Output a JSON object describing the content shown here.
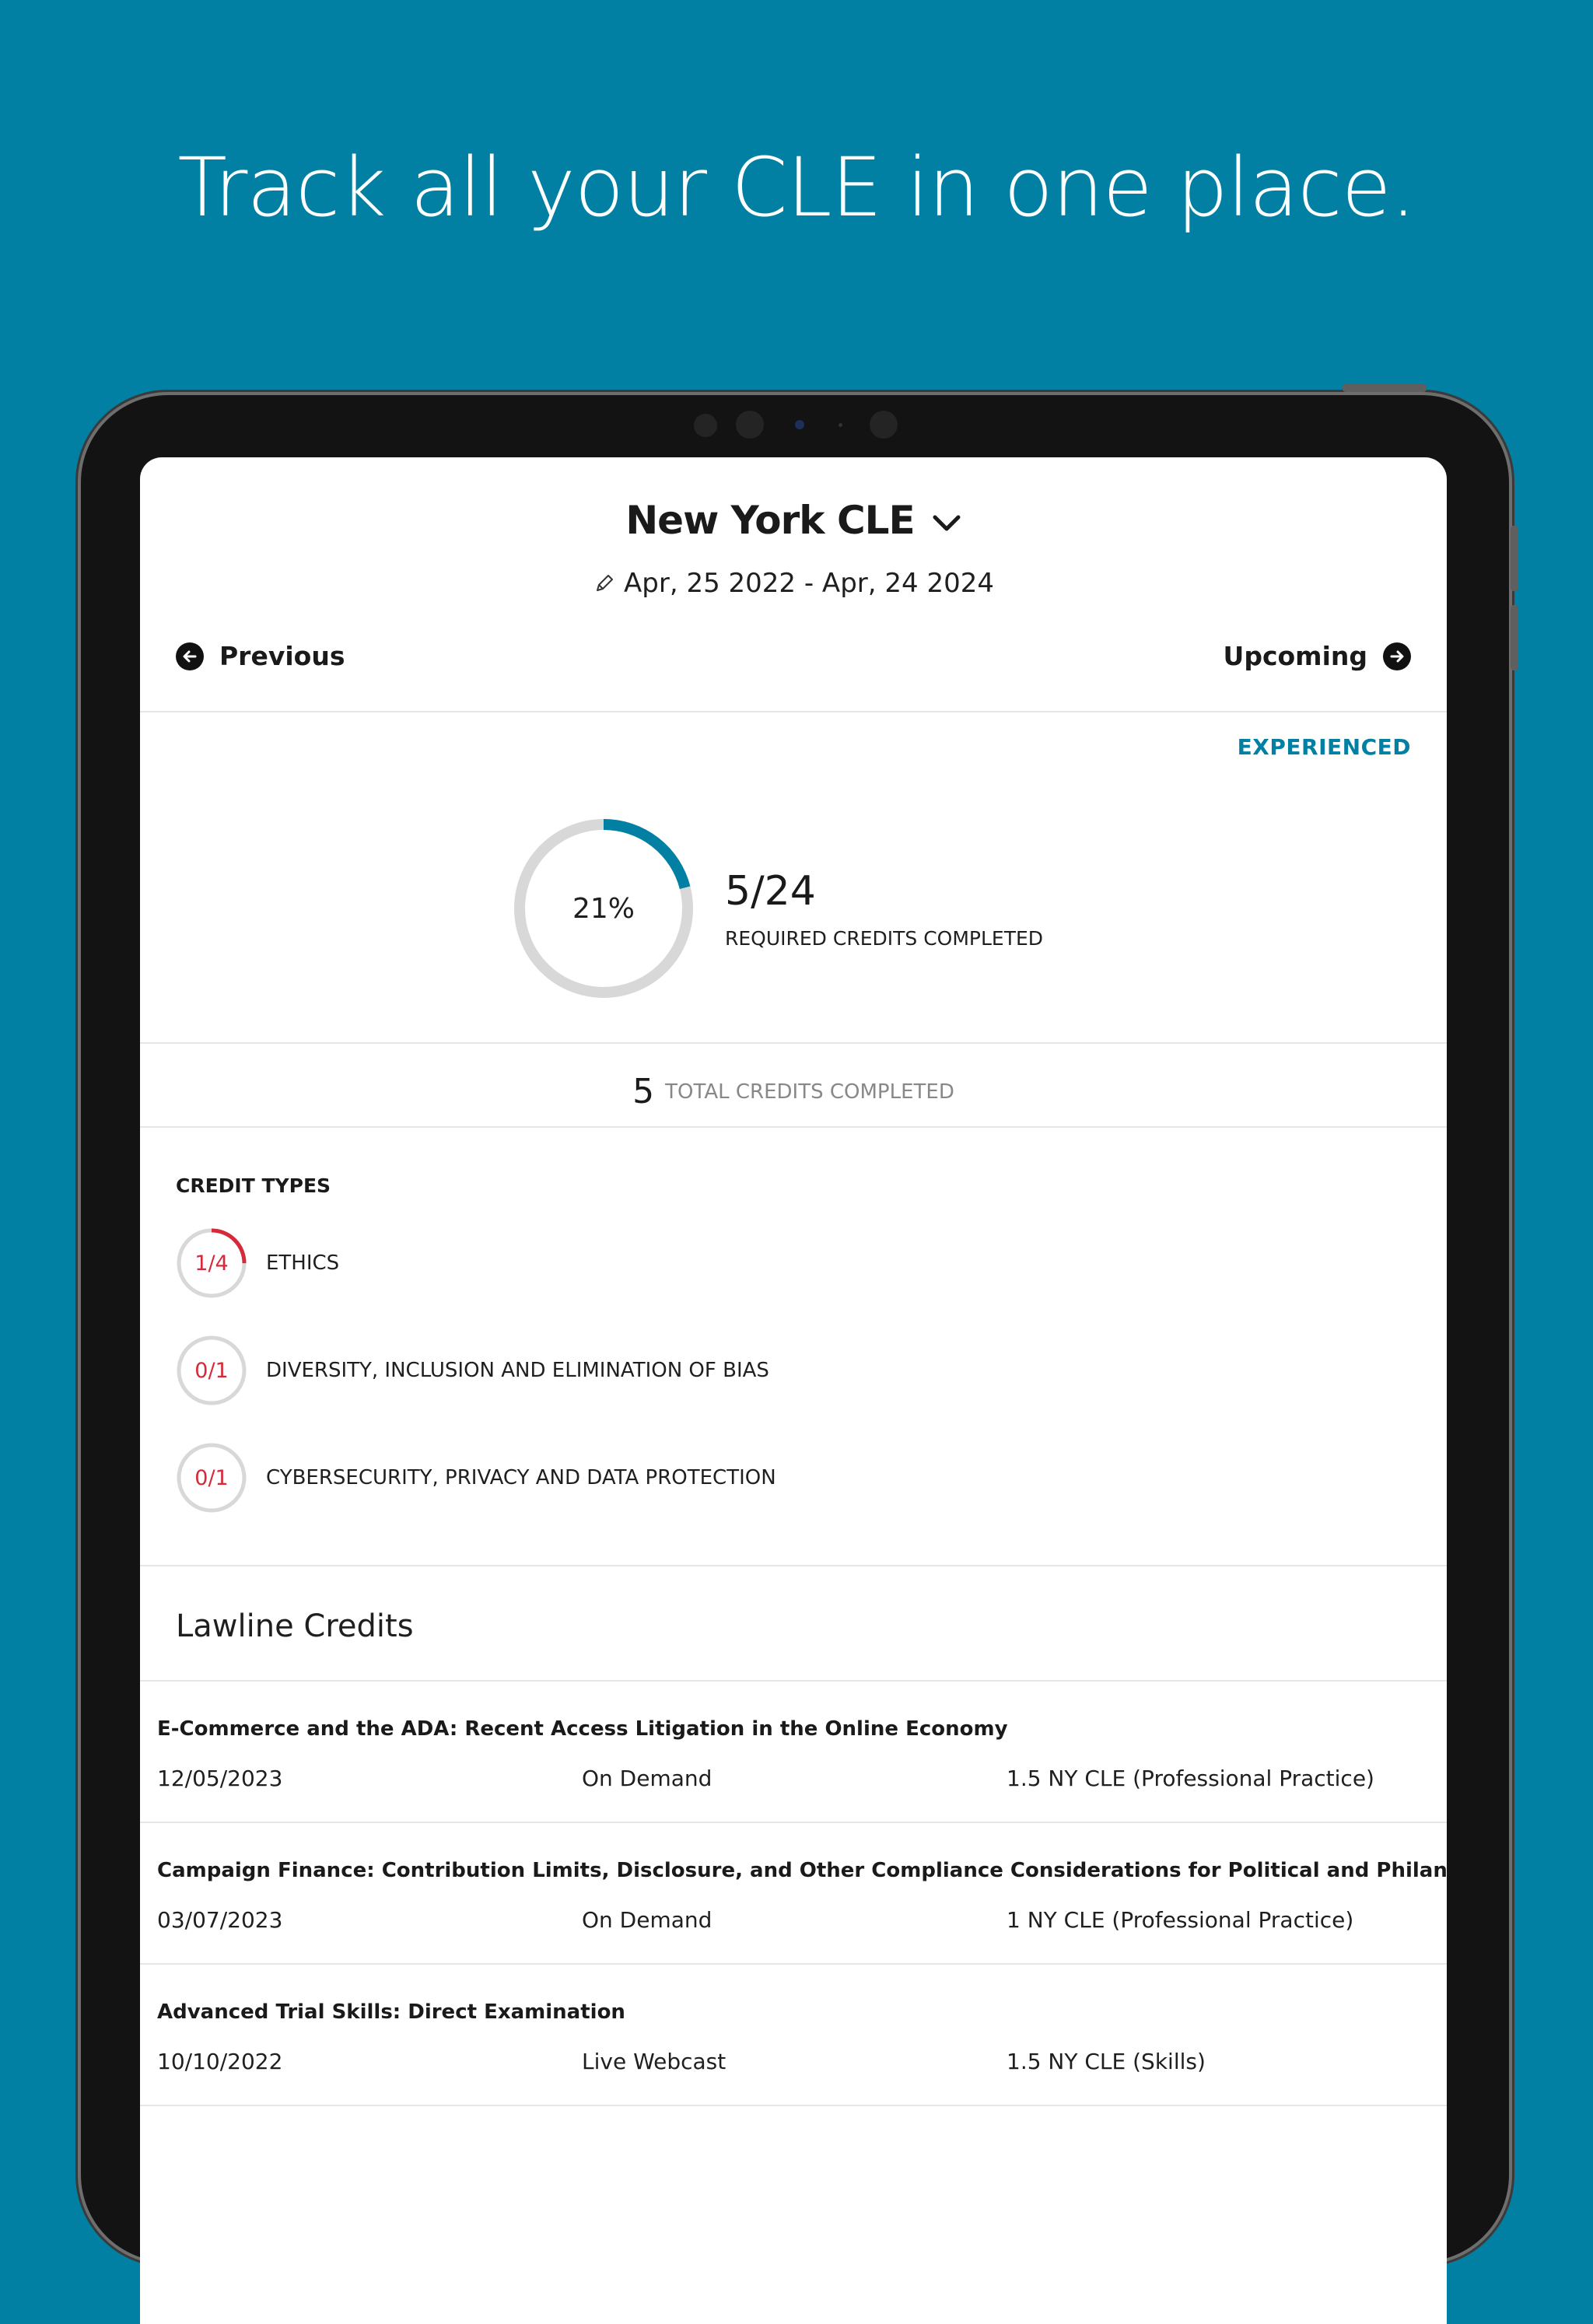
{
  "headline": "Track all your CLE in one place.",
  "header": {
    "title": "New York CLE",
    "date_range": "Apr, 25 2022 - Apr, 24 2024",
    "previous_label": "Previous",
    "upcoming_label": "Upcoming"
  },
  "status_badge": "EXPERIENCED",
  "progress": {
    "percent_label": "21%",
    "fraction": 0.21,
    "required_count": "5/24",
    "required_label": "REQUIRED CREDITS COMPLETED"
  },
  "total": {
    "count": "5",
    "label": "TOTAL CREDITS COMPLETED"
  },
  "credit_types": {
    "title": "CREDIT TYPES",
    "items": [
      {
        "fraction_label": "1/4",
        "fraction": 0.25,
        "name": "ETHICS"
      },
      {
        "fraction_label": "0/1",
        "fraction": 0,
        "name": "DIVERSITY, INCLUSION AND ELIMINATION OF BIAS"
      },
      {
        "fraction_label": "0/1",
        "fraction": 0,
        "name": "CYBERSECURITY, PRIVACY AND DATA PROTECTION"
      }
    ]
  },
  "lawline": {
    "title": "Lawline Credits",
    "items": [
      {
        "title": "E-Commerce and the ADA: Recent Access Litigation in the Online Economy",
        "date": "12/05/2023",
        "type": "On Demand",
        "credits": "1.5 NY CLE (Professional Practice)"
      },
      {
        "title": "Campaign Finance: Contribution Limits, Disclosure, and Other Compliance Considerations for Political and Philanthropic Giving",
        "date": "03/07/2023",
        "type": "On Demand",
        "credits": "1 NY CLE (Professional Practice)"
      },
      {
        "title": "Advanced Trial Skills: Direct Examination",
        "date": "10/10/2022",
        "type": "Live Webcast",
        "credits": "1.5 NY CLE (Skills)"
      }
    ]
  },
  "colors": {
    "background": "#0180a3",
    "accent": "#0180a3",
    "alert": "#d6293a",
    "ring_track": "#d8d8d8"
  }
}
